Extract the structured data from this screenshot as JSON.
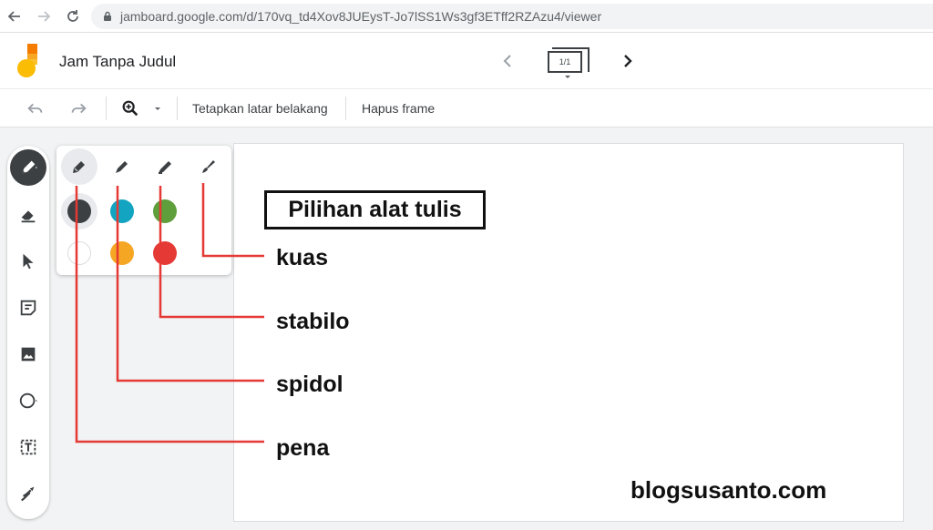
{
  "browser": {
    "url": "jamboard.google.com/d/170vq_td4Xov8JUEysT-Jo7lSS1Ws3gf3ETff2RZAzu4/viewer"
  },
  "header": {
    "title": "Jam Tanpa Judul",
    "frame_counter": "1/1"
  },
  "toolbar": {
    "set_background": "Tetapkan latar belakang",
    "delete_frame": "Hapus frame"
  },
  "pen_panel": {
    "pen_types": [
      "pen",
      "marker",
      "highlighter",
      "brush"
    ],
    "colors": [
      "#3c4043",
      "#12a4c0",
      "#5e9e3b",
      "#ffffff",
      "#f5a623",
      "#e53935"
    ]
  },
  "annotations": {
    "title": "Pilihan alat tulis",
    "kuas": "kuas",
    "stabilo": "stabilo",
    "spidol": "spidol",
    "pena": "pena",
    "line_color": "#e53935"
  },
  "watermark": "blogsusanto.com",
  "icons": {
    "back": "arrow-back-icon",
    "forward": "arrow-forward-icon",
    "reload": "reload-icon",
    "lock": "lock-icon"
  }
}
